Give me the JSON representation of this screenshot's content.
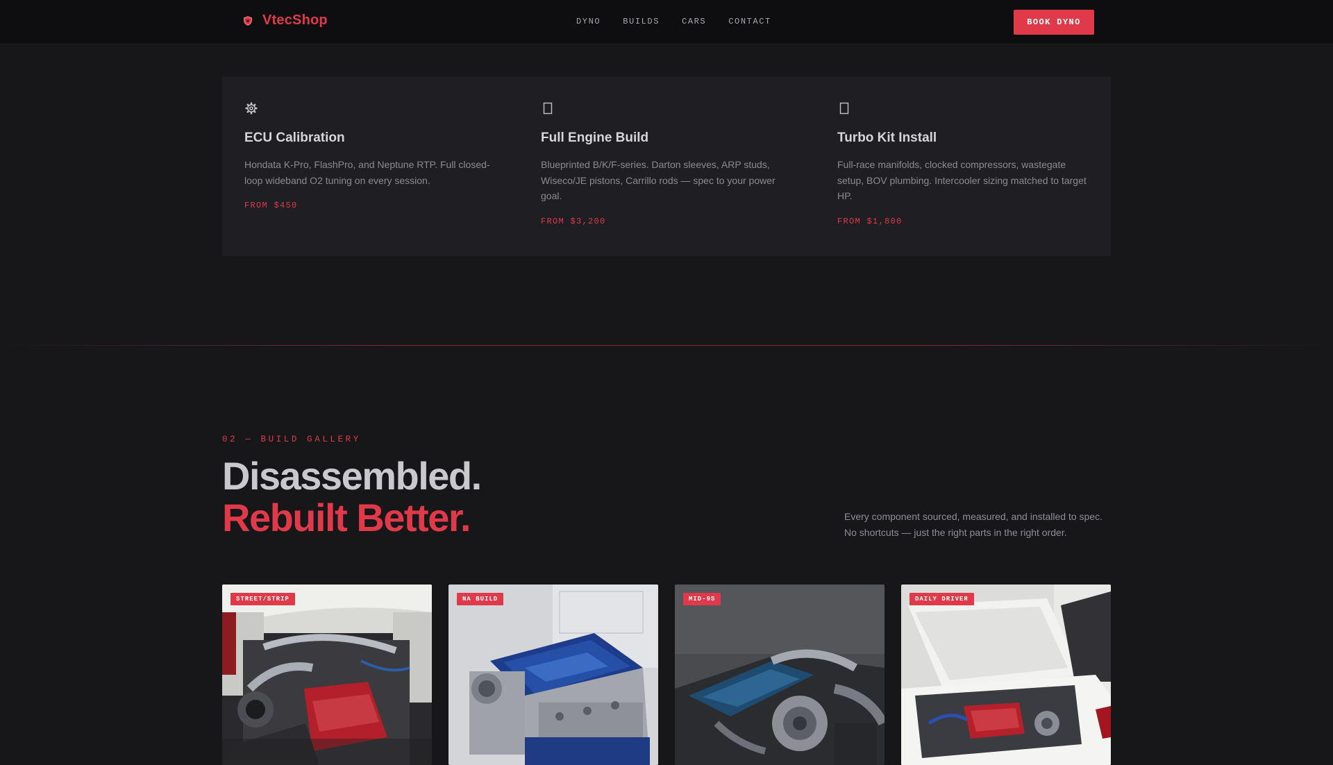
{
  "header": {
    "brand": "VtecShop",
    "nav": [
      "DYNO",
      "BUILDS",
      "CARS",
      "CONTACT"
    ],
    "cta": "BOOK DYNO"
  },
  "services": [
    {
      "icon": "gear-icon",
      "title": "ECU Calibration",
      "description": "Hondata K-Pro, FlashPro, and Neptune RTP. Full closed-loop wideband O2 tuning on every session.",
      "price": "FROM $450"
    },
    {
      "icon": "engine-icon",
      "title": "Full Engine Build",
      "description": "Blueprinted B/K/F-series. Darton sleeves, ARP studs, Wiseco/JE pistons, Carrillo rods — spec to your power goal.",
      "price": "FROM $3,200"
    },
    {
      "icon": "turbo-icon",
      "title": "Turbo Kit Install",
      "description": "Full-race manifolds, clocked compressors, wastegate setup, BOV plumbing. Intercooler sizing matched to target HP.",
      "price": "FROM $1,800"
    }
  ],
  "gallery_section": {
    "label": "02 — BUILD GALLERY",
    "headline_line1": "Disassembled.",
    "headline_line2": "Rebuilt Better.",
    "intro": "Every component sourced, measured, and installed to spec. No shortcuts — just the right parts in the right order."
  },
  "gallery": [
    {
      "tag": "STREET/STRIP"
    },
    {
      "tag": "NA BUILD"
    },
    {
      "tag": "MID-9S"
    },
    {
      "tag": "DAILY DRIVER"
    }
  ],
  "colors": {
    "accent": "#e03a4a",
    "background": "#17171a",
    "card": "#1e1e23",
    "header": "#0e0e10"
  }
}
